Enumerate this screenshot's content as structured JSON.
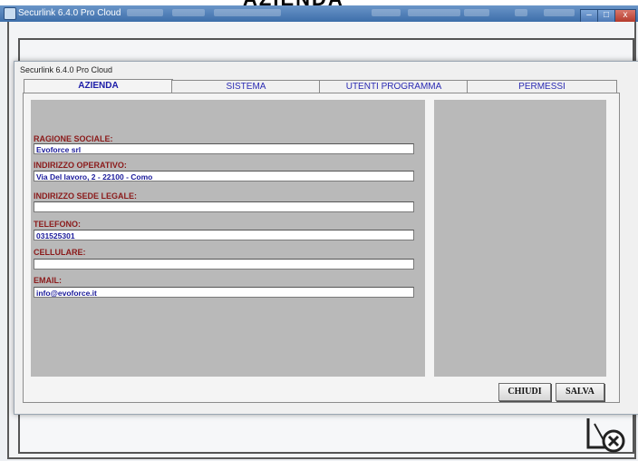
{
  "page_caption": "AZIENDA",
  "app_window": {
    "title": "Securlink 6.4.0 Pro Cloud",
    "controls": {
      "minimize": "–",
      "maximize": "□",
      "close": "x"
    }
  },
  "dialog": {
    "title": "Securlink 6.4.0 Pro Cloud",
    "tabs": [
      {
        "label": "AZIENDA",
        "active": true
      },
      {
        "label": "SISTEMA",
        "active": false
      },
      {
        "label": "UTENTI PROGRAMMA",
        "active": false
      },
      {
        "label": "PERMESSI",
        "active": false
      }
    ],
    "fields": [
      {
        "label": "RAGIONE SOCIALE:",
        "value": "Evoforce srl"
      },
      {
        "label": "INDIRIZZO OPERATIVO:",
        "value": "Via Del lavoro, 2 - 22100 - Como"
      },
      {
        "label": "INDIRIZZO SEDE LEGALE:",
        "value": ""
      },
      {
        "label": "TELEFONO:",
        "value": "031525301"
      },
      {
        "label": "CELLULARE:",
        "value": ""
      },
      {
        "label": "EMAIL:",
        "value": "info@evoforce.it"
      }
    ],
    "buttons": {
      "close": "CHIUDI",
      "save": "SALVA"
    }
  },
  "colors": {
    "label": "#8b1a1a",
    "input_text": "#1a1a9a",
    "tab_text": "#2b2bb3",
    "panel": "#b9b9b9"
  }
}
